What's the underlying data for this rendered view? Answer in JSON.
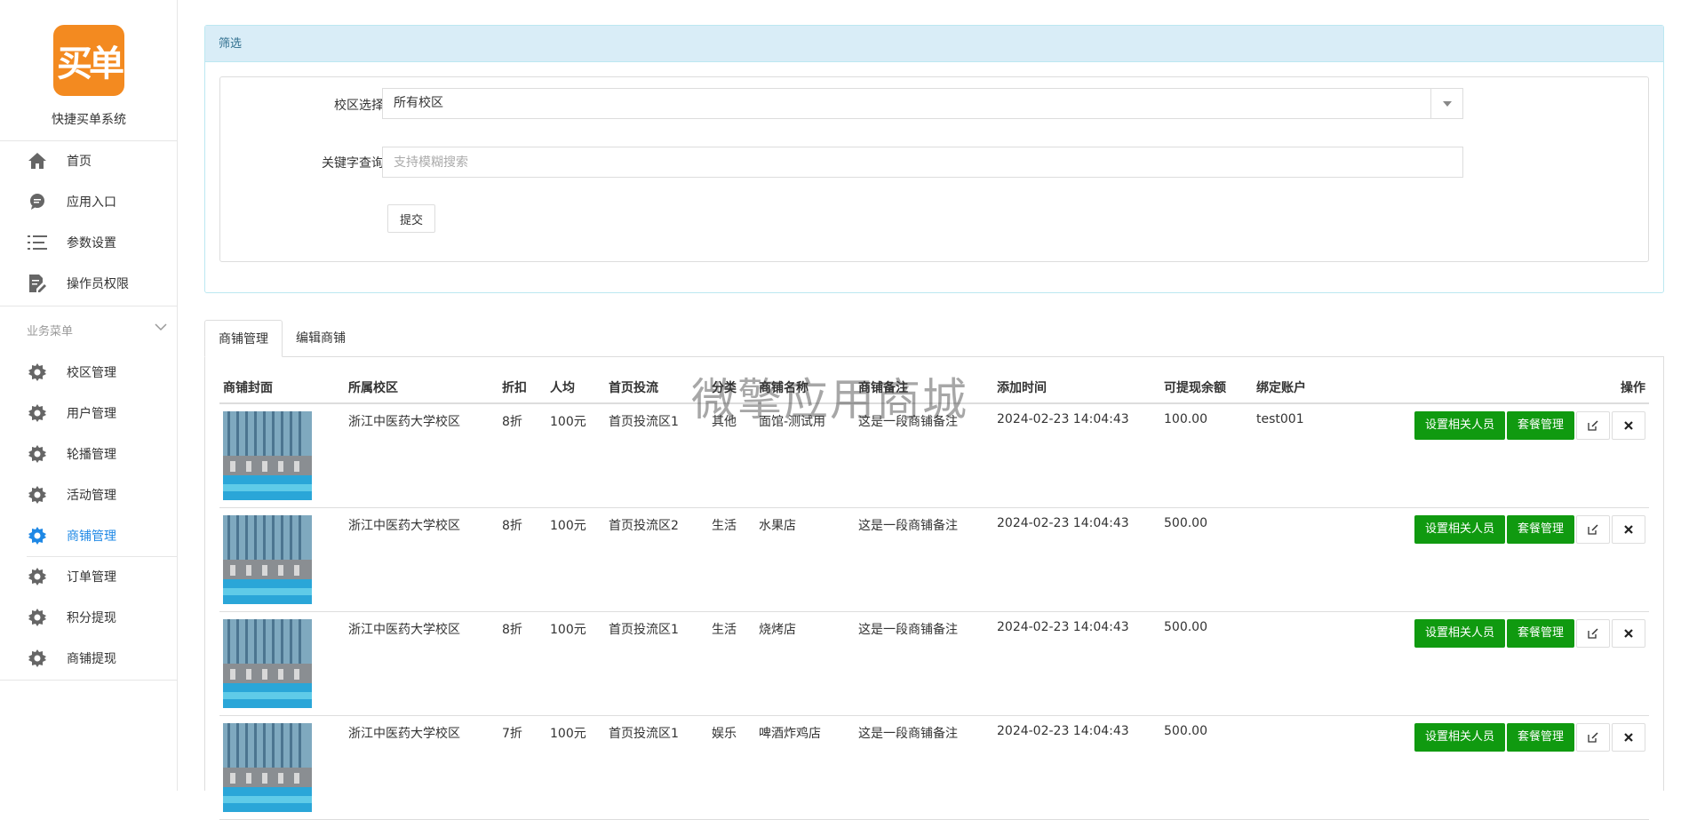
{
  "sidebar": {
    "logo_text": "买单",
    "app_name": "快捷买单系统",
    "items": [
      {
        "label": "首页",
        "icon": "home-icon"
      },
      {
        "label": "应用入口",
        "icon": "chat-bubble-icon"
      },
      {
        "label": "参数设置",
        "icon": "list-icon"
      },
      {
        "label": "操作员权限",
        "icon": "edit-document-icon"
      }
    ],
    "group_title": "业务菜单",
    "business_items": [
      {
        "label": "校区管理",
        "icon": "gear-icon"
      },
      {
        "label": "用户管理",
        "icon": "gear-icon"
      },
      {
        "label": "轮播管理",
        "icon": "gear-icon"
      },
      {
        "label": "活动管理",
        "icon": "gear-icon"
      },
      {
        "label": "商铺管理",
        "icon": "gear-icon",
        "active": true
      },
      {
        "label": "订单管理",
        "icon": "gear-icon"
      },
      {
        "label": "积分提现",
        "icon": "gear-icon"
      },
      {
        "label": "商铺提现",
        "icon": "gear-icon"
      }
    ]
  },
  "filter": {
    "title": "筛选",
    "campus_label": "校区选择",
    "campus_value": "所有校区",
    "keyword_label": "关键字查询",
    "keyword_placeholder": "支持模糊搜索",
    "submit_label": "提交"
  },
  "tabs": [
    {
      "label": "商铺管理",
      "active": true
    },
    {
      "label": "编辑商铺",
      "active": false
    }
  ],
  "table": {
    "headers": [
      "商铺封面",
      "所属校区",
      "折扣",
      "人均",
      "首页投流",
      "分类",
      "商铺名称",
      "商铺备注",
      "添加时间",
      "可提现余额",
      "绑定账户",
      "操作"
    ],
    "rows": [
      {
        "campus": "浙江中医药大学校区",
        "discount": "8折",
        "avg": "100元",
        "zone": "首页投流区1",
        "category": "其他",
        "name": "面馆-测试用",
        "note": "这是一段商铺备注",
        "time": "2024-02-23 14:04:43",
        "balance": "100.00",
        "account": "test001"
      },
      {
        "campus": "浙江中医药大学校区",
        "discount": "8折",
        "avg": "100元",
        "zone": "首页投流区2",
        "category": "生活",
        "name": "水果店",
        "note": "这是一段商铺备注",
        "time": "2024-02-23 14:04:43",
        "balance": "500.00",
        "account": ""
      },
      {
        "campus": "浙江中医药大学校区",
        "discount": "8折",
        "avg": "100元",
        "zone": "首页投流区1",
        "category": "生活",
        "name": "烧烤店",
        "note": "这是一段商铺备注",
        "time": "2024-02-23 14:04:43",
        "balance": "500.00",
        "account": ""
      },
      {
        "campus": "浙江中医药大学校区",
        "discount": "7折",
        "avg": "100元",
        "zone": "首页投流区1",
        "category": "娱乐",
        "name": "啤酒炸鸡店",
        "note": "这是一段商铺备注",
        "time": "2024-02-23 14:04:43",
        "balance": "500.00",
        "account": ""
      }
    ],
    "actions": {
      "set_staff": "设置相关人员",
      "package": "套餐管理"
    }
  },
  "watermark": "微擎应用商城",
  "colors": {
    "accent": "#1e88e5",
    "logo": "#f38a20",
    "green_button": "#109a10",
    "panel_head": "#d9edf7"
  }
}
